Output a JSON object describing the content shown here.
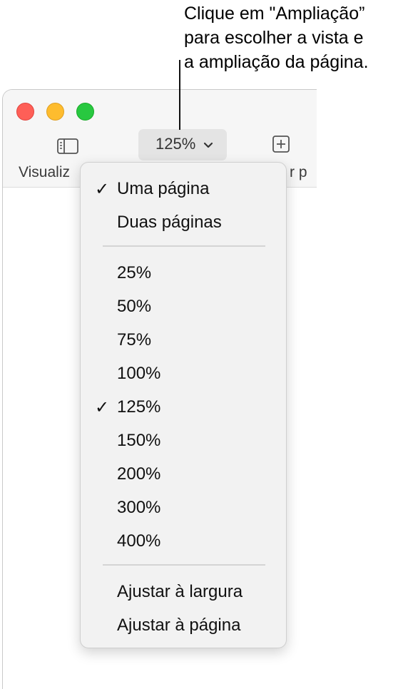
{
  "callout": {
    "lines": [
      "Clique em \"Ampliação”",
      "para escolher a vista e",
      "a ampliação da página."
    ]
  },
  "toolbar": {
    "view_label": "Visualiz",
    "add_label": "r p",
    "zoom_value": "125%"
  },
  "menu": {
    "view_items": [
      {
        "label": "Uma página",
        "checked": true
      },
      {
        "label": "Duas páginas",
        "checked": false
      }
    ],
    "zoom_items": [
      {
        "label": "25%",
        "checked": false
      },
      {
        "label": "50%",
        "checked": false
      },
      {
        "label": "75%",
        "checked": false
      },
      {
        "label": "100%",
        "checked": false
      },
      {
        "label": "125%",
        "checked": true
      },
      {
        "label": "150%",
        "checked": false
      },
      {
        "label": "200%",
        "checked": false
      },
      {
        "label": "300%",
        "checked": false
      },
      {
        "label": "400%",
        "checked": false
      }
    ],
    "fit_items": [
      {
        "label": "Ajustar à largura",
        "checked": false
      },
      {
        "label": "Ajustar à página",
        "checked": false
      }
    ],
    "check_glyph": "✓"
  },
  "colors": {
    "close": "#fe5f57",
    "minimize": "#febc2e",
    "zoom": "#28c840"
  }
}
